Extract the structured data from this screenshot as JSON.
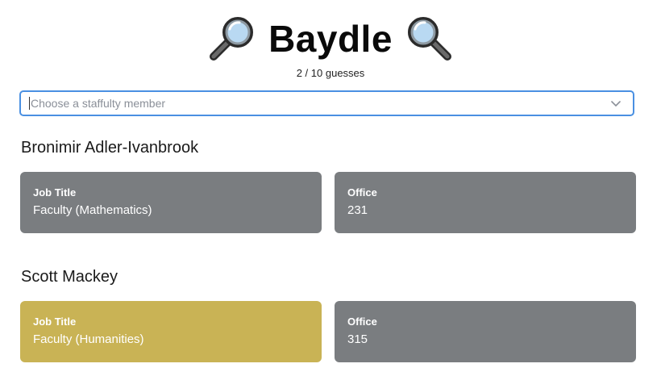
{
  "header": {
    "title": "Baydle",
    "left_icon": "magnifying-glass-left-icon",
    "right_icon": "magnifying-glass-right-icon"
  },
  "progress": {
    "text": "2 / 10 guesses",
    "used": 2,
    "total": 10
  },
  "search": {
    "placeholder": "Choose a staffulty member",
    "value": ""
  },
  "guesses": [
    {
      "name": "Bronimir Adler-Ivanbrook",
      "job_title": {
        "label": "Job Title",
        "value": "Faculty (Mathematics)",
        "status": "wrong"
      },
      "office": {
        "label": "Office",
        "value": "231",
        "status": "wrong"
      }
    },
    {
      "name": "Scott Mackey",
      "job_title": {
        "label": "Job Title",
        "value": "Faculty (Humanities)",
        "status": "partial"
      },
      "office": {
        "label": "Office",
        "value": "315",
        "status": "wrong"
      }
    }
  ],
  "colors": {
    "wrong": "#7a7d80",
    "partial": "#c9b355",
    "focus_border": "#4a90e2"
  }
}
